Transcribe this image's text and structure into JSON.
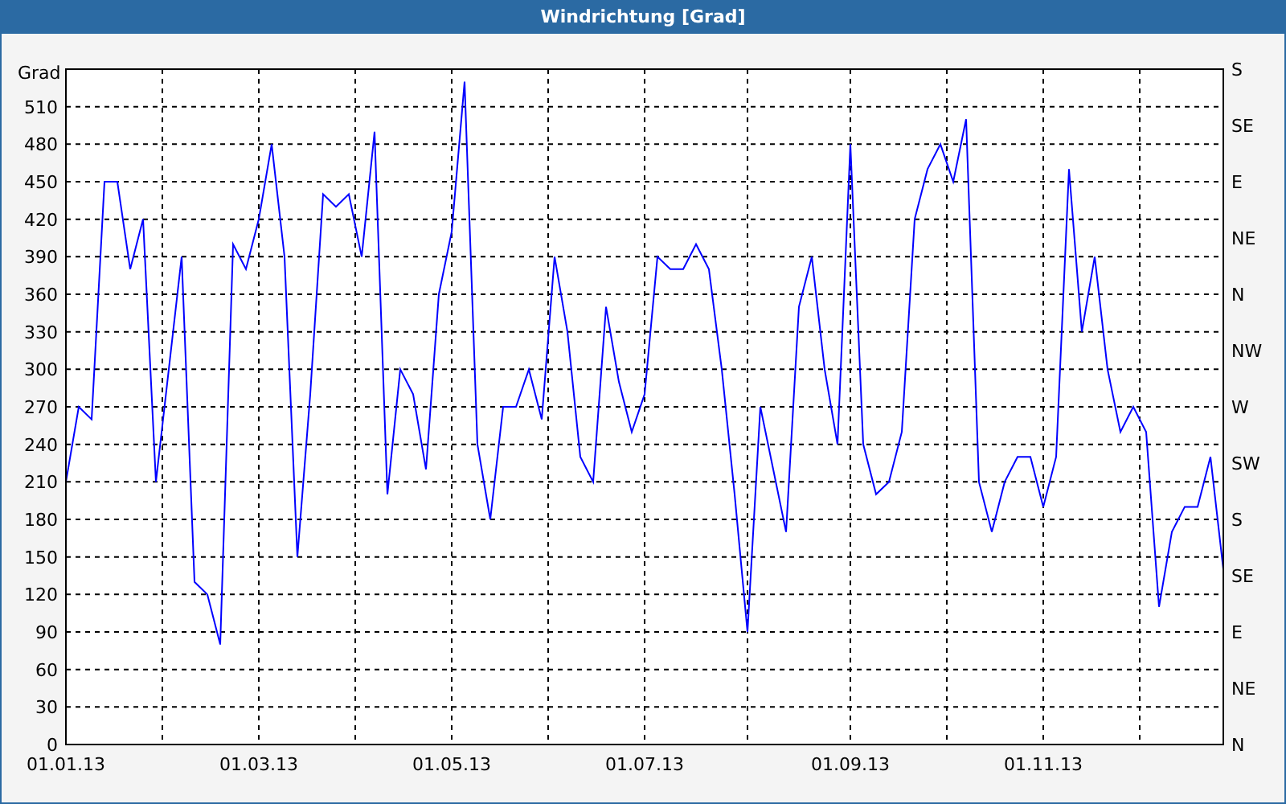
{
  "window": {
    "title": "Windrichtung [Grad]"
  },
  "chart": {
    "chart_data": {
      "type": "line",
      "grid": true,
      "ylabel": "Grad",
      "ylim": [
        0,
        540
      ],
      "yticks": [
        0,
        30,
        60,
        90,
        120,
        150,
        180,
        210,
        240,
        270,
        300,
        330,
        360,
        390,
        420,
        450,
        480,
        510
      ],
      "categories": [
        "01.01.13",
        null,
        null,
        null,
        null,
        null,
        null,
        null,
        null,
        null,
        null,
        null,
        null,
        null,
        null,
        "01.03.13",
        null,
        null,
        null,
        null,
        null,
        null,
        null,
        null,
        null,
        null,
        null,
        null,
        null,
        null,
        "01.05.13",
        null,
        null,
        null,
        null,
        null,
        null,
        null,
        null,
        null,
        null,
        null,
        null,
        null,
        null,
        "01.07.13",
        null,
        null,
        null,
        null,
        null,
        null,
        null,
        null,
        null,
        null,
        null,
        null,
        null,
        null,
        null,
        "01.09.13",
        null,
        null,
        null,
        null,
        null,
        null,
        null,
        null,
        null,
        null,
        null,
        null,
        null,
        null,
        "01.11.13",
        null,
        null,
        null,
        null,
        null,
        null,
        null,
        null,
        null,
        null,
        null,
        null,
        null,
        null
      ],
      "series": [
        {
          "color": "#0000ff",
          "values": [
            210,
            270,
            260,
            450,
            450,
            380,
            420,
            210,
            300,
            390,
            130,
            120,
            80,
            400,
            380,
            420,
            480,
            390,
            150,
            280,
            440,
            430,
            440,
            390,
            490,
            200,
            300,
            280,
            220,
            360,
            410,
            530,
            240,
            180,
            270,
            270,
            300,
            260,
            390,
            330,
            230,
            210,
            350,
            290,
            250,
            280,
            390,
            380,
            380,
            400,
            380,
            300,
            200,
            90,
            270,
            220,
            170,
            350,
            390,
            300,
            240,
            480,
            240,
            200,
            210,
            250,
            420,
            460,
            480,
            450,
            500,
            210,
            170,
            210,
            230,
            230,
            190,
            230,
            460,
            330,
            390,
            300,
            250,
            270,
            250,
            110,
            170,
            190,
            190,
            230,
            140
          ]
        }
      ]
    },
    "compass_axis": [
      "S",
      "SE",
      "E",
      "NE",
      "N",
      "NW",
      "W",
      "SW",
      "S",
      "SE",
      "E",
      "NE",
      "N"
    ]
  }
}
